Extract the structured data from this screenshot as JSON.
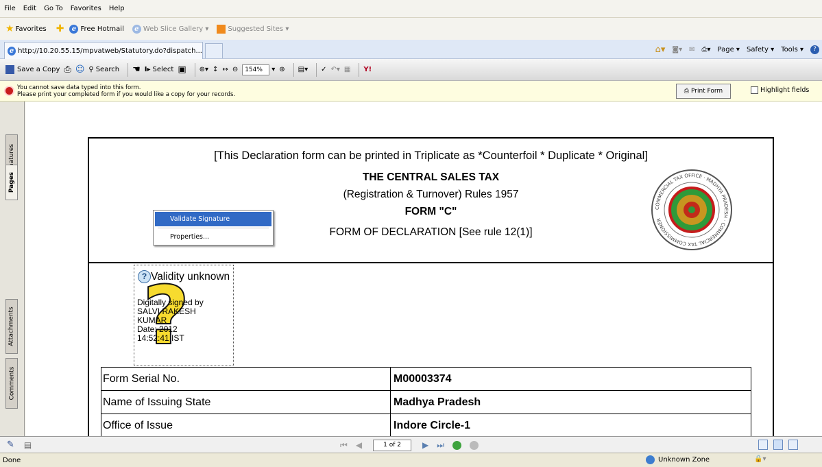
{
  "menu": [
    "File",
    "Edit",
    "Go To",
    "Favorites",
    "Help"
  ],
  "favorites": {
    "label": "Favorites",
    "links": [
      "Free Hotmail",
      "Web Slice Gallery ▾",
      "Suggested Sites ▾"
    ]
  },
  "tab": {
    "title": "http://10.20.55.15/mpvatweb/Statutory.do?dispatch..."
  },
  "command_bar": [
    "Page ▾",
    "Safety ▾",
    "Tools ▾"
  ],
  "acro_toolbar": {
    "save_copy": "Save a Copy",
    "search": "Search",
    "select": "Select",
    "zoom": "154%"
  },
  "notice": {
    "line1": "You cannot save data typed into this form.",
    "line2": "Please print your completed form if you would like a copy for your records.",
    "print_button": "Print Form",
    "highlight": "Highlight fields"
  },
  "side_tabs": [
    "Signatures",
    "Pages",
    "Attachments",
    "Comments"
  ],
  "form": {
    "header_note": "[This Declaration form can be printed in Triplicate as *Counterfoil * Duplicate * Original]",
    "title": "THE CENTRAL SALES TAX",
    "subtitle": "(Registration & Turnover) Rules 1957",
    "form_name": "FORM \"C\"",
    "declaration": "FORM OF DECLARATION [See rule 12(1)]",
    "seal_text": "COMMERCIAL TAX OFFICE · MADHYA PRADESH · COMMERCIAL TAX COMMISSIONER",
    "signature": {
      "status": "Validity unknown",
      "lines": [
        "Digitally signed by",
        "SALVI RAKESH",
        "KUMAR",
        "Date: 2012",
        "14:52:41 IST"
      ]
    },
    "rows": [
      {
        "label": "Form Serial No.",
        "value": "M00003374"
      },
      {
        "label": "Name of Issuing State",
        "value": "Madhya Pradesh"
      },
      {
        "label": "Office of Issue",
        "value": "Indore Circle-1"
      }
    ]
  },
  "context_menu": {
    "items": [
      "Validate Signature",
      "Properties..."
    ]
  },
  "pager": {
    "page": "1 of 2"
  },
  "status": {
    "left": "Done",
    "zone": "Unknown Zone"
  }
}
